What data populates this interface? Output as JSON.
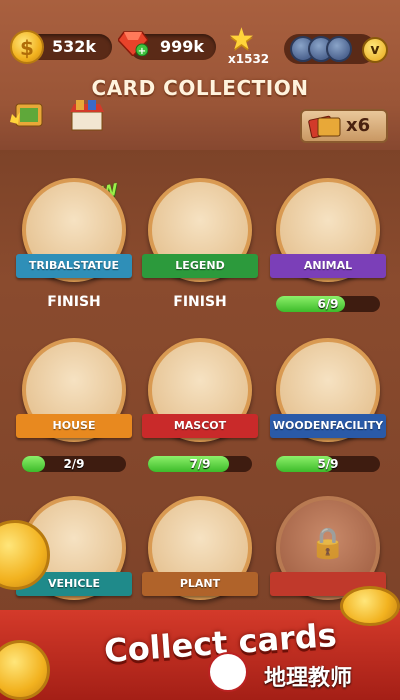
{
  "header": {
    "coins": "532k",
    "gems": "999k",
    "stars": "x1532",
    "vip_label": "v",
    "title": "CARD COLLECTION",
    "multiplier": "x6"
  },
  "cards": [
    {
      "name": "TRIBALSTATUE",
      "status": "FINISH",
      "progress": null,
      "is_new": true,
      "ribbon_color": "#2f8fb8"
    },
    {
      "name": "LEGEND",
      "status": "FINISH",
      "progress": null,
      "is_new": false,
      "ribbon_color": "#2c9a3c"
    },
    {
      "name": "ANIMAL",
      "status": "6/9",
      "progress": 0.667,
      "is_new": false,
      "ribbon_color": "#7b3fb8"
    },
    {
      "name": "HOUSE",
      "status": "2/9",
      "progress": 0.222,
      "is_new": false,
      "ribbon_color": "#e8891f"
    },
    {
      "name": "MASCOT",
      "status": "7/9",
      "progress": 0.778,
      "is_new": false,
      "ribbon_color": "#c92a2a"
    },
    {
      "name": "WOODENFACILITY",
      "status": "5/9",
      "progress": 0.556,
      "is_new": false,
      "ribbon_color": "#2a5aa8"
    },
    {
      "name": "VEHICLE",
      "status": "",
      "progress": null,
      "is_new": false,
      "ribbon_color": "#1f8a8a"
    },
    {
      "name": "PLANT",
      "status": "",
      "progress": null,
      "is_new": false,
      "ribbon_color": "#b0632a"
    },
    {
      "name": "",
      "status": "",
      "progress": null,
      "is_new": false,
      "ribbon_color": "#c0392b"
    }
  ],
  "new_tag": "NEW",
  "promo": {
    "text": "Collect cards"
  },
  "watermark": {
    "text": "地理教师"
  },
  "icons": [
    "coin-icon",
    "gem-icon",
    "star-icon",
    "badge-icon",
    "vip-icon",
    "trophy-icon",
    "shop-icon",
    "card-pack-icon",
    "lock-icon"
  ]
}
